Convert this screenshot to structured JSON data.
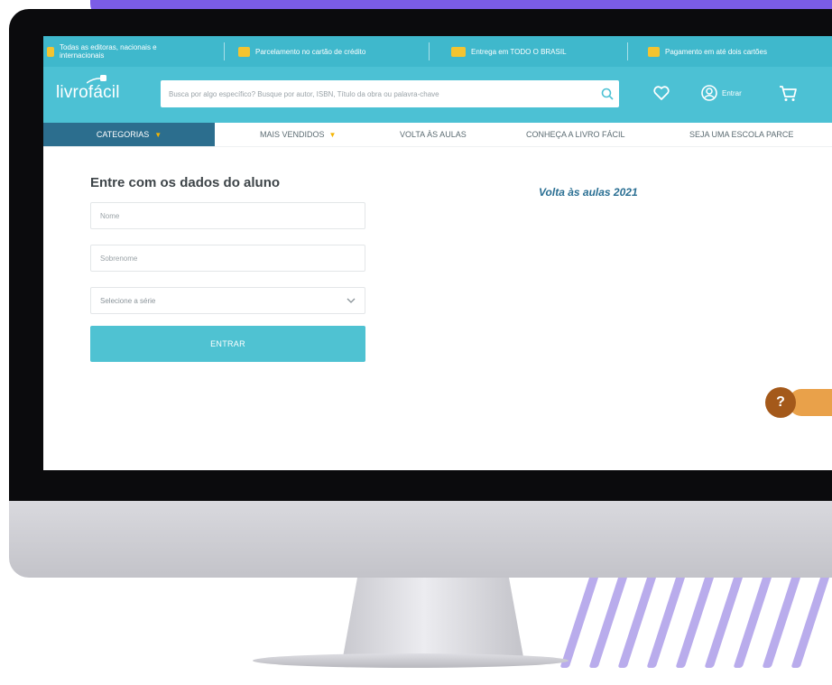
{
  "topbar": {
    "items": [
      {
        "text": "Todas as editoras, nacionais e internacionais",
        "icon": "book-icon"
      },
      {
        "text": "Parcelamento no cartão de crédito",
        "icon": "card-icon"
      },
      {
        "text": "Entrega em TODO O BRASIL",
        "icon": "truck-icon"
      },
      {
        "text": "Pagamento em até dois cartões",
        "icon": "payment-icon"
      }
    ]
  },
  "header": {
    "logo": "livrofácil",
    "search_placeholder": "Busca por algo específico? Busque por autor, ISBN, Título da obra ou palavra-chave",
    "login_label": "Entrar"
  },
  "nav": {
    "categories": "CATEGORIAS",
    "items": [
      "MAIS VENDIDOS",
      "VOLTA ÀS AULAS",
      "CONHEÇA A LIVRO FÁCIL",
      "SEJA UMA ESCOLA PARCE"
    ]
  },
  "form": {
    "title": "Entre com os dados do aluno",
    "first_name_placeholder": "Nome",
    "last_name_placeholder": "Sobrenome",
    "grade_select": "Selecione a série",
    "submit_label": "ENTRAR"
  },
  "side": {
    "title": "Volta às aulas 2021"
  },
  "help": {
    "label": "?"
  },
  "colors": {
    "accent": "#4cc1d4",
    "nav_dark": "#2c6e8e",
    "brand_purple": "#7b5ce6",
    "help": "#a4591a"
  }
}
